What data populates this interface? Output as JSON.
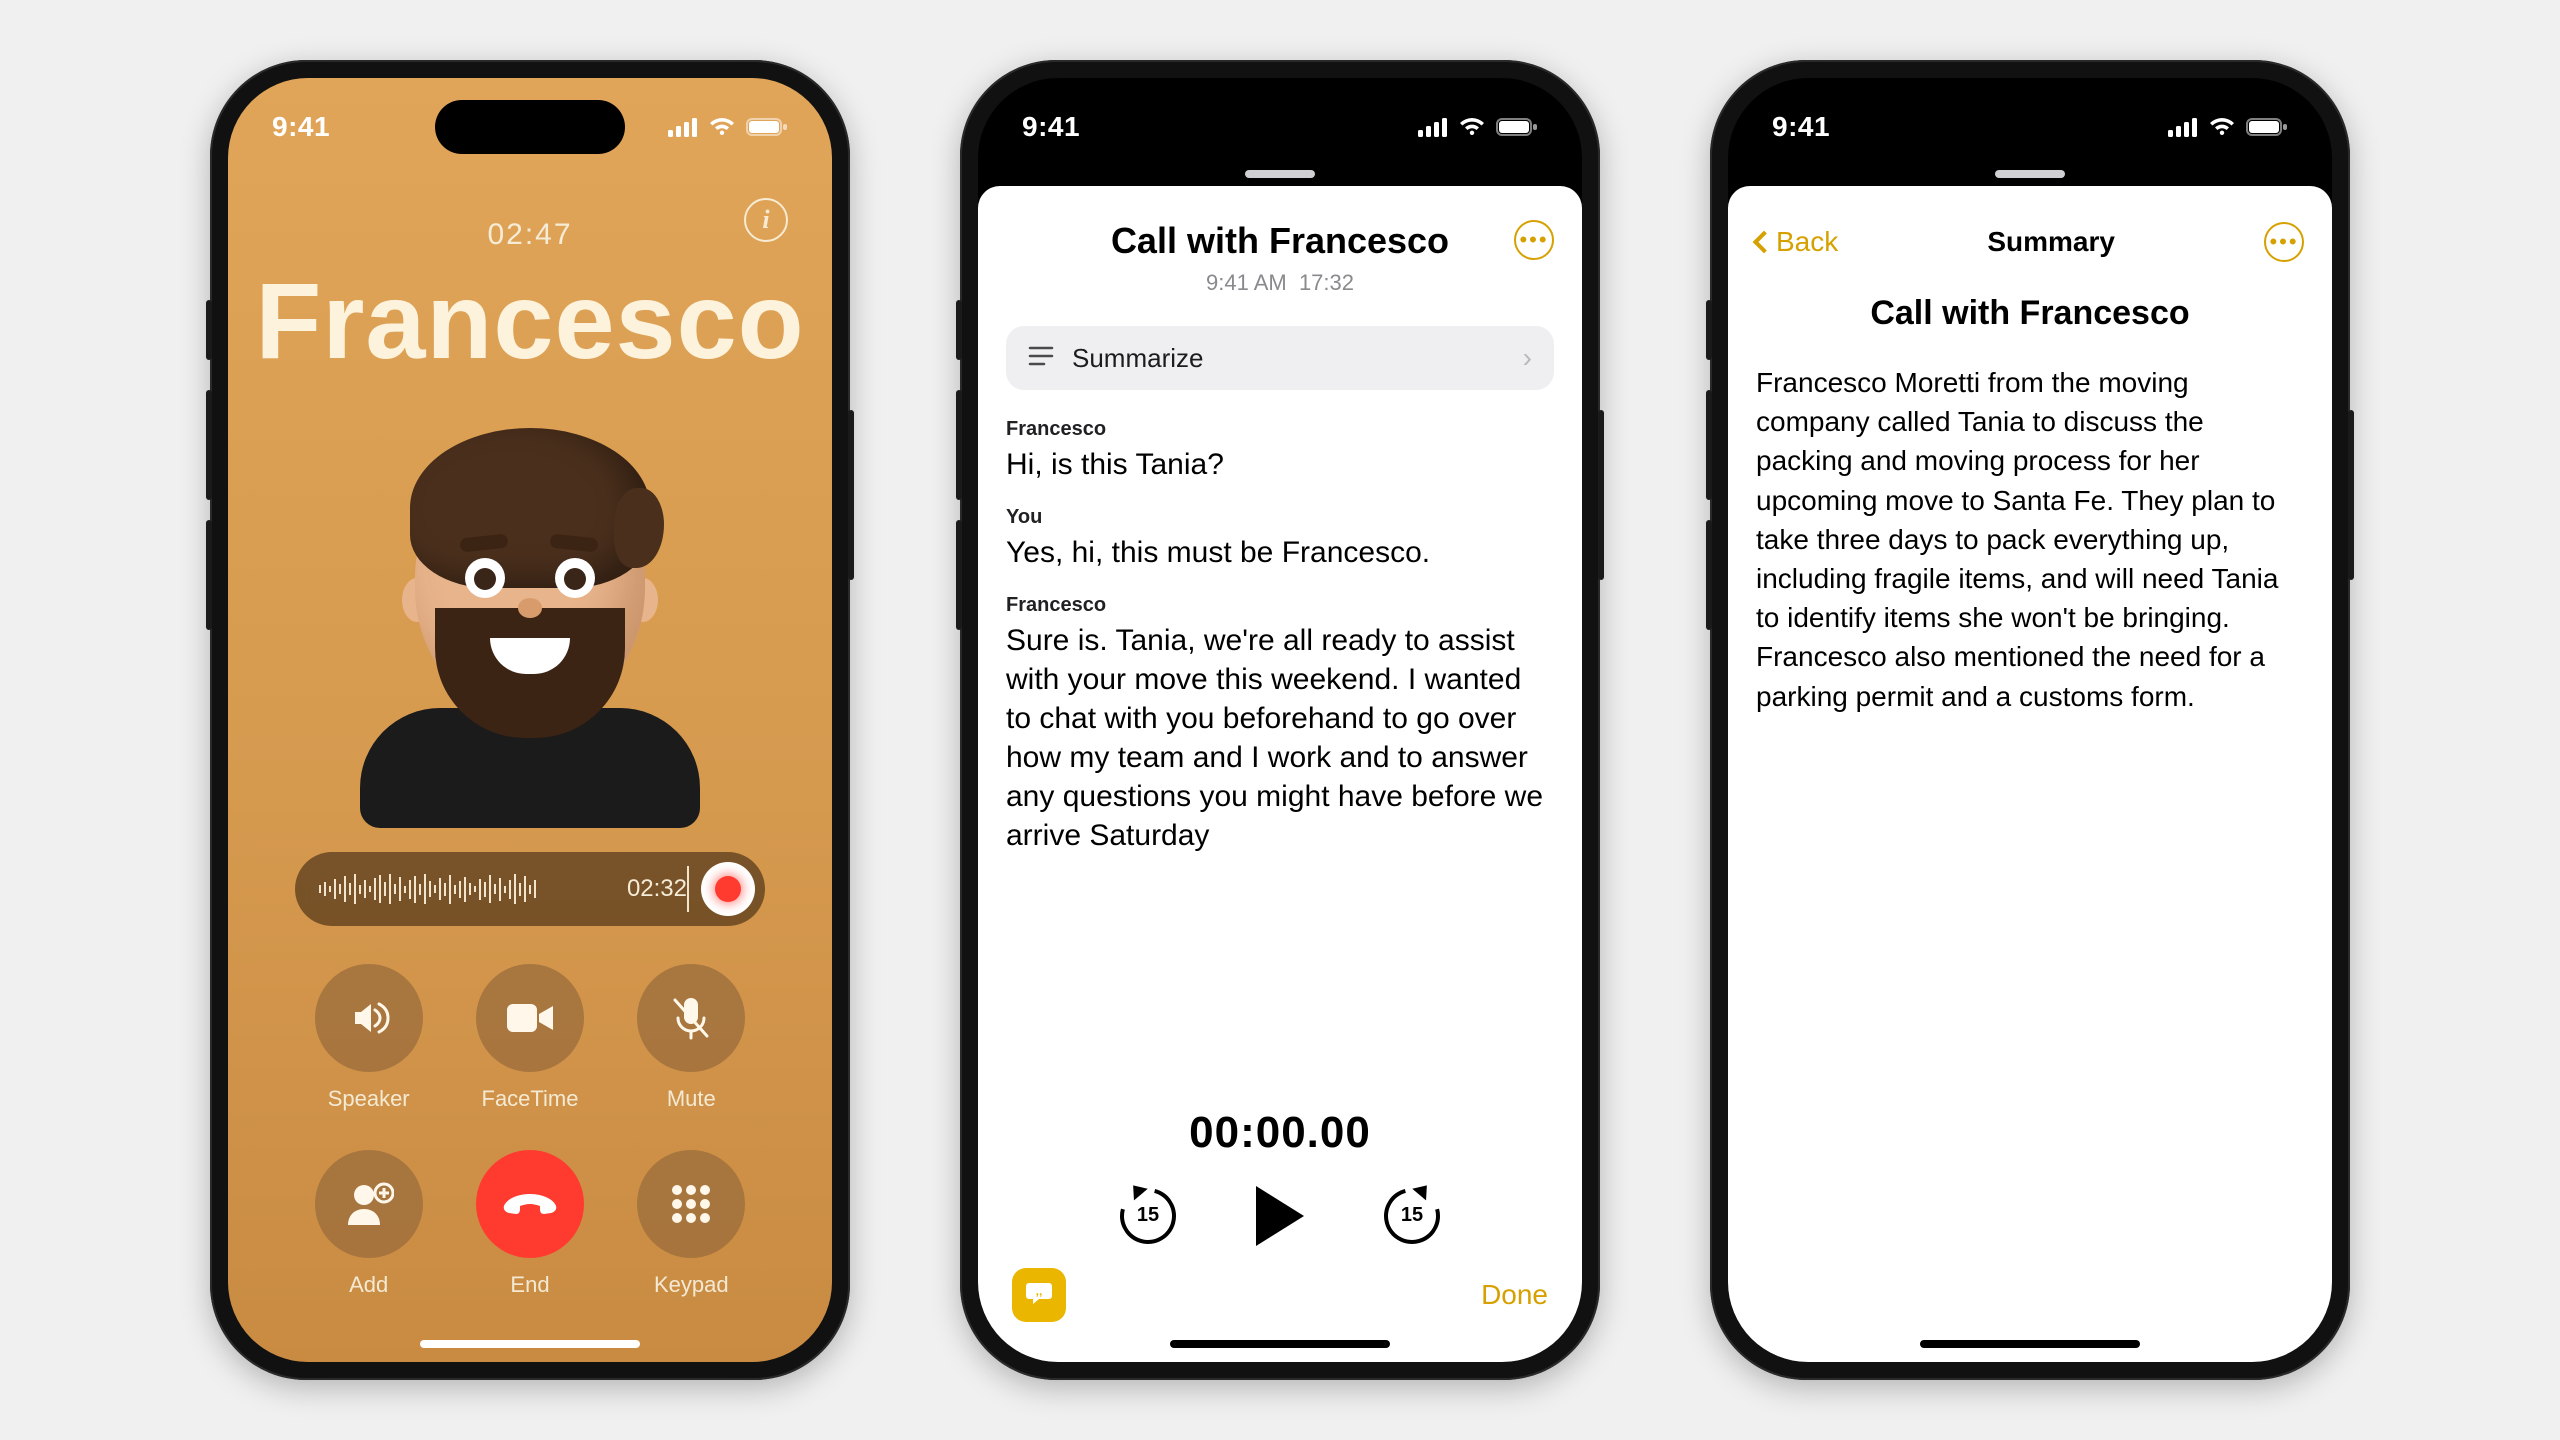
{
  "status": {
    "time": "9:41"
  },
  "colors": {
    "accent": "#d6a100",
    "end_call": "#ff3b30"
  },
  "call": {
    "duration": "02:47",
    "contact_name": "Francesco",
    "recording_elapsed": "02:32",
    "buttons": {
      "speaker": "Speaker",
      "facetime": "FaceTime",
      "mute": "Mute",
      "add": "Add",
      "end": "End",
      "keypad": "Keypad"
    }
  },
  "transcript": {
    "title": "Call with Francesco",
    "subtitle_time": "9:41 AM",
    "subtitle_duration": "17:32",
    "summarize_label": "Summarize",
    "playback_time": "00:00.00",
    "skip_seconds": "15",
    "done_label": "Done",
    "entries": [
      {
        "speaker": "Francesco",
        "text": "Hi, is this Tania?"
      },
      {
        "speaker": "You",
        "text": "Yes, hi, this must be Francesco."
      },
      {
        "speaker": "Francesco",
        "text": "Sure is. Tania, we're all ready to assist with your move this weekend. I wanted to chat with you beforehand to go over how my team and I work and to answer any questions you might have before we arrive Saturday"
      }
    ]
  },
  "summary": {
    "back_label": "Back",
    "nav_title": "Summary",
    "heading": "Call with Francesco",
    "body": "Francesco Moretti from the moving company called Tania to discuss the packing and moving process for her upcoming move to Santa Fe. They plan to take three days to pack everything up, including fragile items, and will need Tania to identify items she won't be bringing. Francesco also mentioned the need for a parking permit and a customs form."
  }
}
